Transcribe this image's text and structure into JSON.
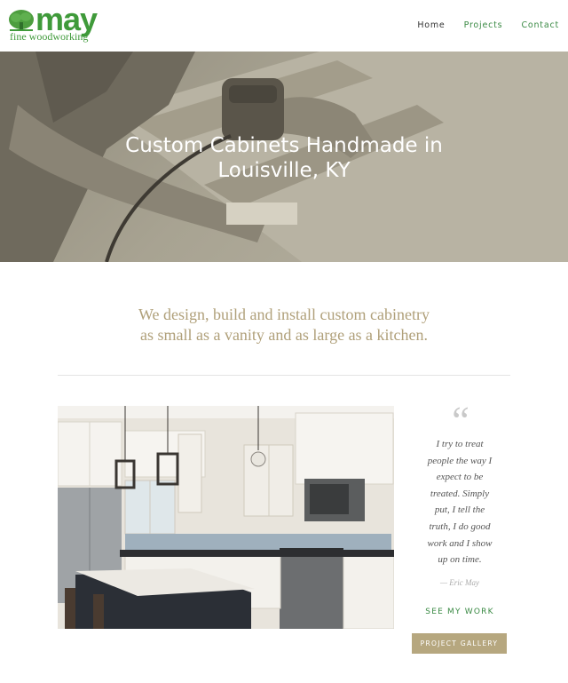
{
  "brand": {
    "name": "may",
    "tagline": "fine woodworking",
    "green": "#3f9a3a"
  },
  "nav": {
    "items": [
      {
        "label": "Home",
        "active": true
      },
      {
        "label": "Projects",
        "active": false
      },
      {
        "label": "Contact",
        "active": false
      }
    ]
  },
  "hero": {
    "title_line1": "Custom Cabinets Handmade in",
    "title_line2": "Louisville, KY"
  },
  "intro": {
    "line1": "We design, build and install custom cabinetry",
    "line2": "as small as a vanity and as large as a kitchen."
  },
  "testimonial": {
    "mark": "“",
    "lines": [
      "I try to treat",
      "people the way I",
      "expect to be",
      "treated. Simply",
      "put, I tell the",
      "truth, I do good",
      "work and I show",
      "up on time."
    ],
    "author": "— Eric May",
    "link_label": "SEE MY WORK",
    "button_label": "PROJECT GALLERY"
  },
  "colors": {
    "accent_green": "#3a8a44",
    "gold": "#b0a07a",
    "button": "#b6a77f"
  }
}
